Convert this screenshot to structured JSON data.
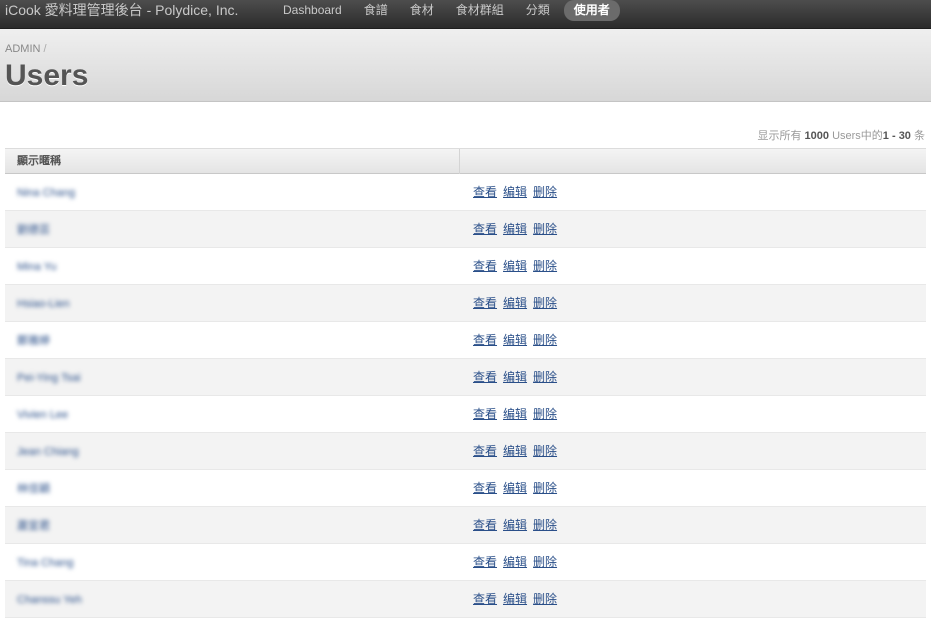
{
  "nav": {
    "brand": "iCook 愛料理管理後台 - Polydice, Inc.",
    "items": [
      {
        "label": "Dashboard",
        "active": false
      },
      {
        "label": "食譜",
        "active": false
      },
      {
        "label": "食材",
        "active": false
      },
      {
        "label": "食材群組",
        "active": false
      },
      {
        "label": "分類",
        "active": false
      },
      {
        "label": "使用者",
        "active": true
      }
    ]
  },
  "header": {
    "breadcrumb": "ADMIN",
    "breadcrumb_sep": "/",
    "title": "Users"
  },
  "pagination": {
    "prefix": "显示所有",
    "total": "1000",
    "middle": "Users中的",
    "range": "1 - 30",
    "suffix": "条"
  },
  "table": {
    "columns": [
      "顯示暱稱",
      ""
    ],
    "rows": [
      {
        "name": "Nina Chang"
      },
      {
        "name": "劉德芸"
      },
      {
        "name": "Mina Yu"
      },
      {
        "name": "Hsiao-Lien"
      },
      {
        "name": "鄭雅婷"
      },
      {
        "name": "Pei-Ying Tsai"
      },
      {
        "name": "Vivien Lee"
      },
      {
        "name": "Jean Chiang"
      },
      {
        "name": "林佳穎"
      },
      {
        "name": "蕭宜君"
      },
      {
        "name": "Tina Chang"
      },
      {
        "name": "Chanssu Yeh"
      }
    ],
    "actions": {
      "view": "查看",
      "edit": "编辑",
      "delete": "删除"
    }
  },
  "colors": {
    "link": "#2a4f89",
    "nav_bg": "#3a3a3a",
    "active_pill": "#6b6b6b"
  }
}
